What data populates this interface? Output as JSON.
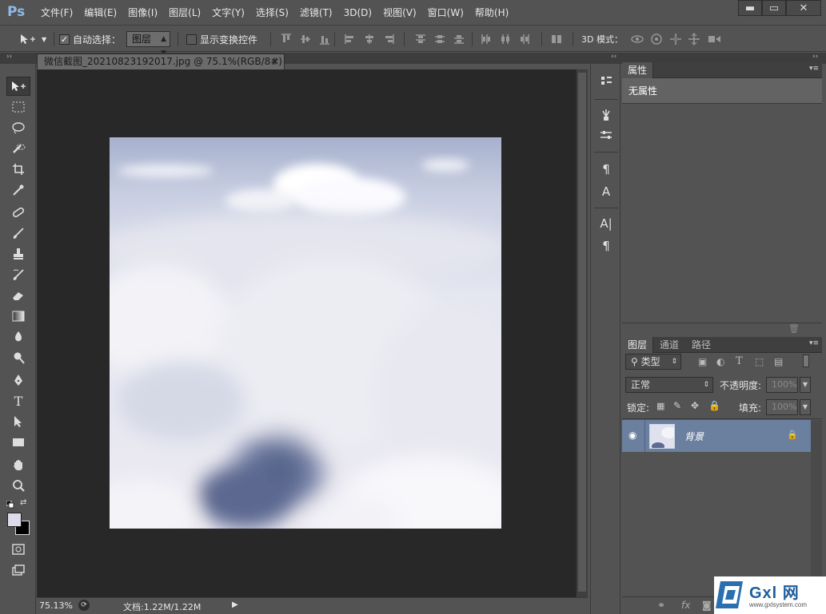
{
  "app": {
    "logo": "Ps"
  },
  "menubar": {
    "items": [
      "文件(F)",
      "编辑(E)",
      "图像(I)",
      "图层(L)",
      "文字(Y)",
      "选择(S)",
      "滤镜(T)",
      "3D(D)",
      "视图(V)",
      "窗口(W)",
      "帮助(H)"
    ]
  },
  "window": {
    "minimize": "▬",
    "maximize": "▭",
    "close": "✕"
  },
  "options": {
    "auto_select_label": "自动选择：",
    "auto_select_target": "图层",
    "show_transform_label": "显示变换控件",
    "mode3d_label": "3D 模式："
  },
  "document": {
    "tab_title": "微信截图_20210823192017.jpg @ 75.1%(RGB/8#) *",
    "tab_close": "×",
    "zoom": "75.13%",
    "doc_size": "文档:1.22M/1.22M"
  },
  "properties": {
    "tab": "属性",
    "empty_text": "无属性"
  },
  "layers_panel": {
    "tabs": [
      "图层",
      "通道",
      "路径"
    ],
    "filter_kind": "类型",
    "blend_mode": "正常",
    "opacity_label": "不透明度:",
    "opacity_value": "100%",
    "lock_label": "锁定:",
    "fill_label": "填充:",
    "fill_value": "100%",
    "layers": [
      {
        "name": "背景",
        "visible": true,
        "locked": true
      }
    ]
  },
  "watermark": {
    "brand": "Gxl 网",
    "url": "www.gxlsystem.com"
  }
}
